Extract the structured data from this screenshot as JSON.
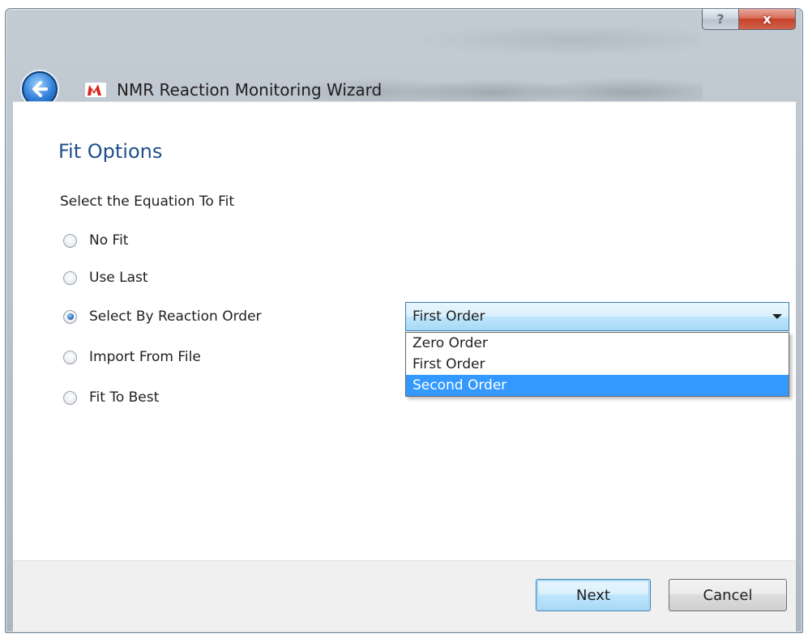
{
  "window": {
    "title": "NMR Reaction Monitoring Wizard",
    "help_glyph": "?",
    "close_glyph": "x"
  },
  "page": {
    "heading": "Fit Options",
    "subheading": "Select the Equation To Fit"
  },
  "options": [
    {
      "label": "No Fit",
      "checked": false
    },
    {
      "label": "Use Last",
      "checked": false
    },
    {
      "label": "Select By Reaction Order",
      "checked": true
    },
    {
      "label": "Import From File",
      "checked": false
    },
    {
      "label": "Fit To Best",
      "checked": false
    }
  ],
  "reaction_order": {
    "selected": "First Order",
    "items": [
      "Zero Order",
      "First Order",
      "Second Order"
    ],
    "highlighted": "Second Order"
  },
  "footer": {
    "next_label": "Next",
    "cancel_label": "Cancel"
  },
  "icons": {
    "back": "back-arrow-icon",
    "app": "mnova-logo-icon",
    "help": "help-icon",
    "close": "close-icon",
    "dropdown": "chevron-down-icon"
  },
  "colors": {
    "heading": "#1f4e8c",
    "selection": "#3399ff",
    "close_button": "#c7432a"
  }
}
